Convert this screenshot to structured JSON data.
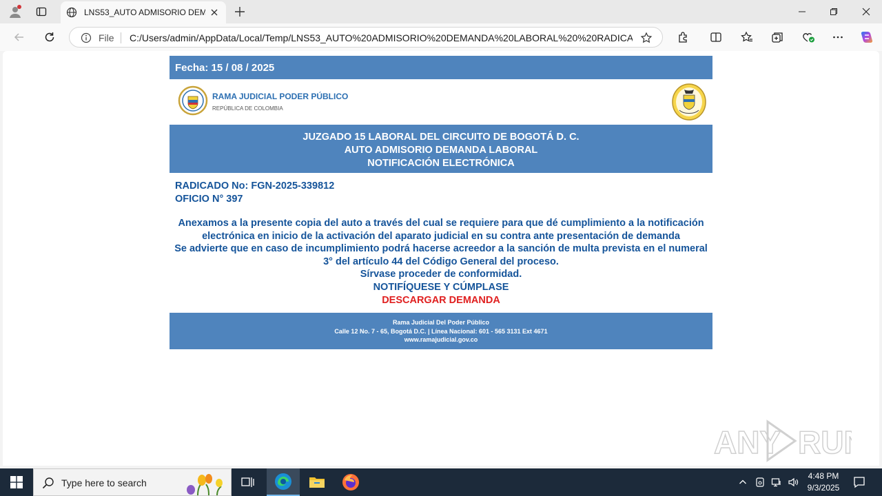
{
  "browser": {
    "tab_title": "LNS53_AUTO ADMISORIO DEMANDA",
    "address_scheme_label": "File",
    "url": "C:/Users/admin/AppData/Local/Temp/LNS53_AUTO%20ADMISORIO%20DEMANDA%20LABORAL%20%20RADICAD..."
  },
  "document": {
    "date_line": "Fecha: 15 / 08 / 2025",
    "org_title": "RAMA JUDICIAL PODER PÚBLICO",
    "org_subtitle": "REPÚBLICA DE COLOMBIA",
    "header_lines": [
      "JUZGADO 15 LABORAL DEL CIRCUITO DE BOGOTÁ D. C.",
      "AUTO ADMISORIO DEMANDA LABORAL",
      "NOTIFICACIÓN ELECTRÓNICA"
    ],
    "radicado": "RADICADO No: FGN-2025-339812",
    "oficio": "OFICIO N° 397",
    "paragraph_1": "Anexamos a la presente copia del auto a través del cual se requiere para que dé cumplimiento a la notificación electrónica en inicio de la activación del aparato judicial en su contra  ante presentación de demanda",
    "paragraph_2": "Se advierte que en caso de incumplimiento podrá hacerse acreedor a la sanción de multa prevista en el numeral 3° del artículo 44 del Código General del proceso.",
    "line_3": "Sírvase proceder de conformidad.",
    "line_4": "NOTIFÍQUESE Y CÚMPLASE",
    "download_link": "DESCARGAR DEMANDA",
    "footer_lines": [
      "Rama Judicial Del Poder Público",
      "Calle 12 No. 7 - 65, Bogotá D.C. | Línea Nacional: 601 - 565 3131 Ext 4671",
      "www.ramajudicial.gov.co"
    ]
  },
  "watermark": "ANY RUN",
  "taskbar": {
    "search_placeholder": "Type here to search",
    "time": "4:48 PM",
    "date": "9/3/2025"
  },
  "colors": {
    "doc_blue_bar": "#4f84bd",
    "doc_text_blue": "#15549a",
    "link_red": "#e02020",
    "taskbar": "#1c2a3a"
  }
}
